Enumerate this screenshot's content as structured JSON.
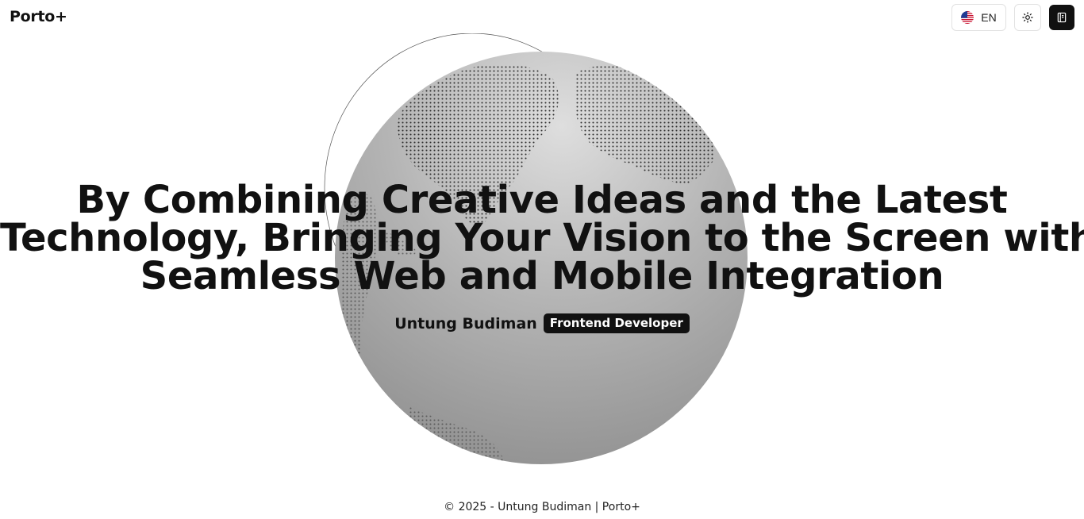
{
  "header": {
    "logo": "Porto+",
    "language": {
      "code": "EN",
      "flag_icon": "us-flag-icon"
    },
    "theme_toggle_icon": "sun-icon",
    "menu_icon": "book-icon"
  },
  "hero": {
    "headline_lines": [
      "By Combining Creative Ideas and the Latest",
      "Technology, Bringing Your Vision to the Screen with",
      "Seamless Web and Mobile Integration"
    ],
    "author_name": "Untung Budiman",
    "author_role": "Frontend Developer"
  },
  "footer": {
    "text": "© 2025 - Untung Budiman | Porto+"
  },
  "colors": {
    "primary": "#111111",
    "background": "#ffffff",
    "globe_light": "#d8d8d8",
    "globe_dark": "#8a8a8a"
  }
}
